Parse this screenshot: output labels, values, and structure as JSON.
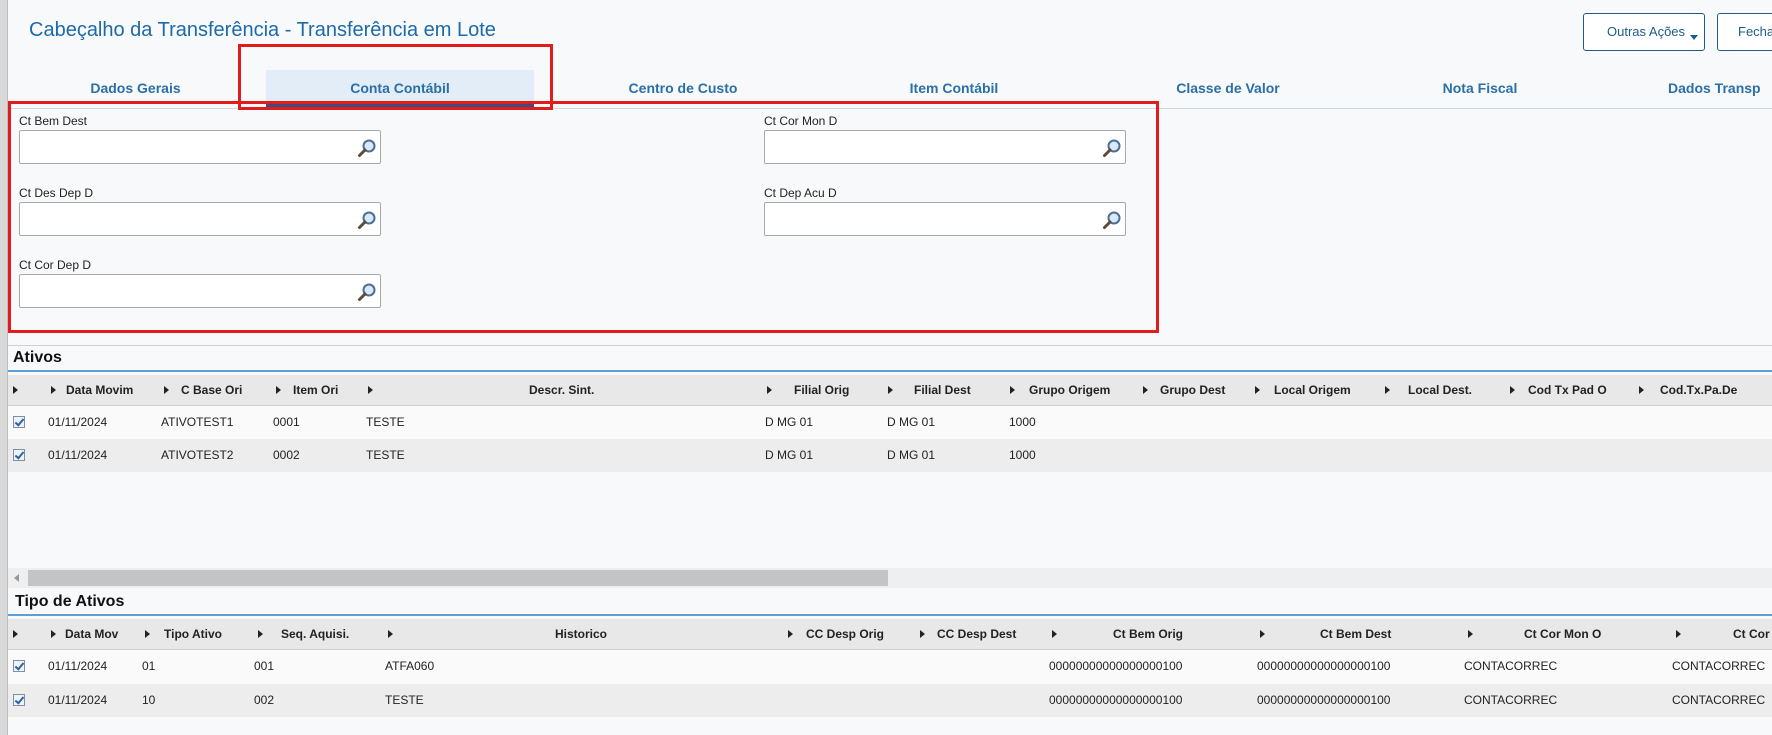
{
  "header": {
    "title": "Cabeçalho da Transferência - Transferência em Lote",
    "buttons": {
      "outras_acoes": "Outras Ações",
      "fechar": "Fechar"
    }
  },
  "tabs": [
    {
      "label": "Dados Gerais",
      "active": false
    },
    {
      "label": "Conta Contábil",
      "active": true
    },
    {
      "label": "Centro de Custo",
      "active": false
    },
    {
      "label": "Item Contábil",
      "active": false
    },
    {
      "label": "Classe de Valor",
      "active": false
    },
    {
      "label": "Nota Fiscal",
      "active": false
    },
    {
      "label": "Dados Transp",
      "active": false
    }
  ],
  "form": {
    "ct_bem_dest": {
      "label": "Ct Bem Dest",
      "value": ""
    },
    "ct_cor_mon_d": {
      "label": "Ct Cor Mon D",
      "value": ""
    },
    "ct_des_dep_d": {
      "label": "Ct Des Dep D",
      "value": ""
    },
    "ct_dep_acu_d": {
      "label": "Ct Dep Acu D",
      "value": ""
    },
    "ct_cor_dep_d": {
      "label": "Ct Cor Dep D",
      "value": ""
    }
  },
  "ativos": {
    "title": "Ativos",
    "columns": [
      "Data Movim",
      "C Base Ori",
      "Item Ori",
      "Descr. Sint.",
      "Filial Orig",
      "Filial Dest",
      "Grupo Origem",
      "Grupo Dest",
      "Local Origem",
      "Local Dest.",
      "Cod Tx Pad O",
      "Cod.Tx.Pa.De"
    ],
    "rows": [
      {
        "data": "01/11/2024",
        "cbase": "ATIVOTEST1",
        "item": "0001",
        "descr": "TESTE",
        "filial_orig": "D MG 01",
        "filial_dest": "D MG 01",
        "grupo_origem": "1000"
      },
      {
        "data": "01/11/2024",
        "cbase": "ATIVOTEST2",
        "item": "0002",
        "descr": "TESTE",
        "filial_orig": "D MG 01",
        "filial_dest": "D MG 01",
        "grupo_origem": "1000"
      }
    ]
  },
  "tipo_ativos": {
    "title": "Tipo de Ativos",
    "columns": [
      "Data Mov",
      "Tipo Ativo",
      "Seq. Aquisi.",
      "Historico",
      "CC Desp Orig",
      "CC Desp Dest",
      "Ct Bem Orig",
      "Ct Bem Dest",
      "Ct Cor Mon O",
      "Ct Cor"
    ],
    "rows": [
      {
        "data": "01/11/2024",
        "tipo": "01",
        "seq": "001",
        "historico": "ATFA060",
        "ct_bem_orig": "00000000000000000100",
        "ct_bem_dest": "00000000000000000100",
        "ct_cor_mon_o": "CONTACORREC",
        "ct_cor": "CONTACORREC"
      },
      {
        "data": "01/11/2024",
        "tipo": "10",
        "seq": "002",
        "historico": "TESTE",
        "ct_bem_orig": "00000000000000000100",
        "ct_bem_dest": "00000000000000000100",
        "ct_cor_mon_o": "CONTACORREC",
        "ct_cor": "CONTACORREC"
      }
    ]
  }
}
